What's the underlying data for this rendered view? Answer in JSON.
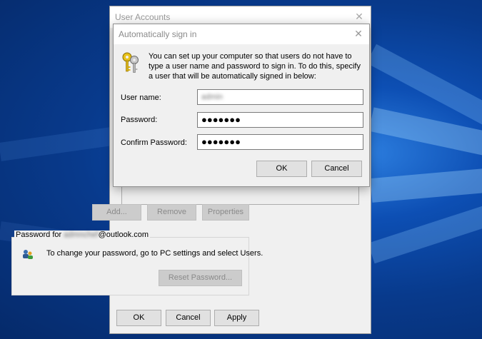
{
  "background_window": {
    "title": "User Accounts",
    "buttons": {
      "add": "Add...",
      "remove": "Remove",
      "properties": "Properties"
    },
    "password_group": {
      "legend_prefix": "Password for ",
      "legend_account_blurred": "admnchef",
      "legend_domain": "@outlook.com",
      "info_text": "To change your password, go to PC settings and select Users.",
      "reset_button": "Reset Password..."
    },
    "footer": {
      "ok": "OK",
      "cancel": "Cancel",
      "apply": "Apply"
    }
  },
  "dialog": {
    "title": "Automatically sign in",
    "description": "You can set up your computer so that users do not have to type a user name and password to sign in. To do this, specify a user that will be automatically signed in below:",
    "fields": {
      "user_name_label": "User name:",
      "user_name_value_blurred": "admin",
      "password_label": "Password:",
      "password_value": "●●●●●●●",
      "confirm_password_label": "Confirm Password:",
      "confirm_password_value": "●●●●●●●"
    },
    "buttons": {
      "ok": "OK",
      "cancel": "Cancel"
    }
  },
  "icons": {
    "close": "close-icon",
    "keys": "keys-icon",
    "password_info": "users-password-icon"
  },
  "colors": {
    "focus_border": "#0078d7",
    "dialog_bg": "#f0f0f0",
    "desktop_blue": "#0b3b86"
  }
}
